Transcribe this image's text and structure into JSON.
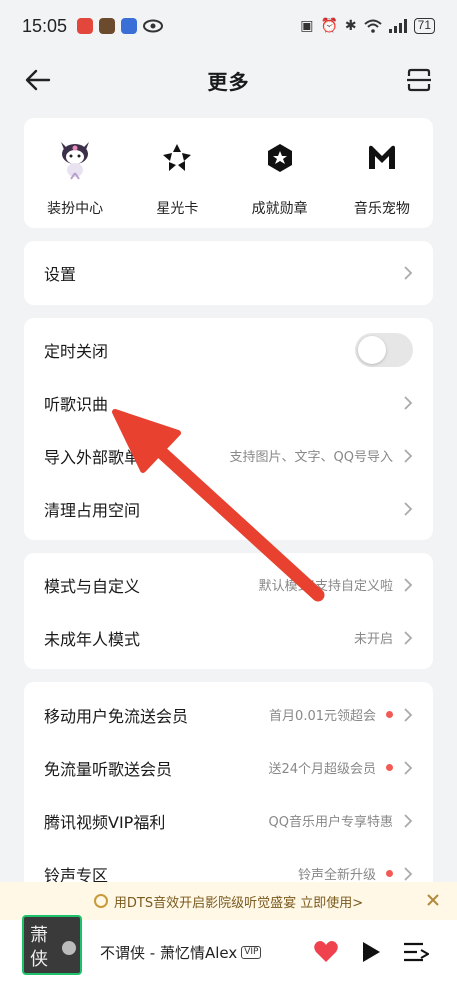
{
  "status_bar": {
    "time": "15:05",
    "battery": "71"
  },
  "header": {
    "title": "更多"
  },
  "grid": [
    {
      "label": "装扮中心",
      "icon": "kuromi-avatar-icon"
    },
    {
      "label": "星光卡",
      "icon": "starlight-icon"
    },
    {
      "label": "成就勋章",
      "icon": "medal-icon"
    },
    {
      "label": "音乐宠物",
      "icon": "music-pet-icon"
    }
  ],
  "group1": {
    "settings": "设置"
  },
  "group2": {
    "sleep_timer": "定时关闭",
    "recognize": "听歌识曲",
    "import_label": "导入外部歌单",
    "import_hint": "支持图片、文字、QQ号导入",
    "clean": "清理占用空间"
  },
  "group3": {
    "mode_label": "模式与自定义",
    "mode_hint": "默认模式|支持自定义啦",
    "minor_label": "未成年人模式",
    "minor_hint": "未开启"
  },
  "group4": {
    "mobile_label": "移动用户免流送会员",
    "mobile_hint": "首月0.01元领超会",
    "free_label": "免流量听歌送会员",
    "free_hint": "送24个月超级会员",
    "tencent_label": "腾讯视频VIP福利",
    "tencent_hint": "QQ音乐用户专享特惠",
    "ringtone_label": "铃声专区",
    "ringtone_hint": "铃声全新升级"
  },
  "banner": {
    "text": "用DTS音效开启影院级听觉盛宴 立即使用>"
  },
  "player": {
    "song": "不谓侠 - 萧忆情Alex",
    "vip": "VIP",
    "cover_line1": "萧",
    "cover_line2": "侠"
  },
  "colors": {
    "accent_red": "#f25b55",
    "arrow_red": "#e8412f",
    "heart": "#f0424e"
  }
}
